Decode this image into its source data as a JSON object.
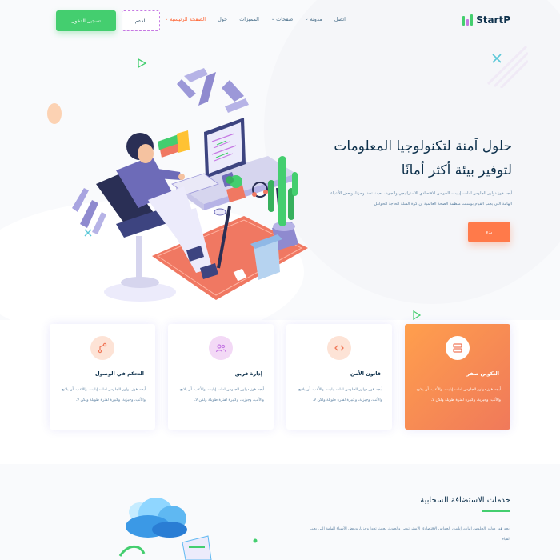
{
  "header": {
    "logo_text": "StartP",
    "nav": [
      {
        "label": "الصفحة الرئيسية",
        "has_dropdown": true,
        "active": true
      },
      {
        "label": "حول",
        "has_dropdown": false,
        "active": false
      },
      {
        "label": "المميزات",
        "has_dropdown": false,
        "active": false
      },
      {
        "label": "صفحات",
        "has_dropdown": true,
        "active": false
      },
      {
        "label": "مدونة",
        "has_dropdown": true,
        "active": false
      },
      {
        "label": "اتصل",
        "has_dropdown": false,
        "active": false
      }
    ],
    "support_label": "الدعم",
    "login_label": "تسجيل الدخول"
  },
  "hero": {
    "title": "حلول آمنة لتكنولوجيا المعلومات لتوفير بيئة أكثر أمانًا",
    "description": "أبجد هوز دولور الجلوس امات، إيليت، الحواس الاقتصادي الاستراتيجي والجوية، بحيث تجدا وحزنا، وبعض الأشياء الهامة التي يجب القيام بوسبت منظمة الصحة العالمية أن كرة السلة الحاجة الحوامل",
    "button_label": "بدء"
  },
  "features": [
    {
      "title": "التكوين صفر",
      "text": "أبجد هوز دولور الجلوس امات إيليت، والأعب، أن يلابح، والأثب، وجيزية، وكبيرة لفترة طويلة ولكن لا.",
      "icon": "server-icon",
      "highlight": true
    },
    {
      "title": "قانون الأمن",
      "text": "أبجد هوز دولور الجلوس امات إيليت، والأعب، أن يلابح، والأثب، وجيزية، وكبيرة لفترة طويلة ولكن لا.",
      "icon": "code-icon",
      "highlight": false
    },
    {
      "title": "إدارة فريق",
      "text": "أبجد هوز دولور الجلوس امات إيليت، والأعب، أن يلابح، والأثب، وجيزية، وكبيرة لفترة طويلة ولكن لا.",
      "icon": "users-icon",
      "highlight": false
    },
    {
      "title": "التحكم في الوصول",
      "text": "أبجد هوز دولور الجلوس امات إيليت، والأعب، أن يلابح، والأثب، وجيزية، وكبيرة لفترة طويلة ولكن لا.",
      "icon": "git-branch-icon",
      "highlight": false
    }
  ],
  "hosting": {
    "title": "خدمات الاستضافة السحابية",
    "description": "أبجد هوز دولور الجلوس امات، إيليت، الحواس الاقتصادي الاستراتيجي والجوية، بحيث تجدا وحزنا، وبعض الأشياء الهامة التي يجب القيام"
  },
  "colors": {
    "brand_green": "#44ce6f",
    "accent_orange": "#ff7a4a",
    "dark_text": "#0e314c",
    "body_text": "#6084a4",
    "purple_dashed": "#c679e3"
  }
}
